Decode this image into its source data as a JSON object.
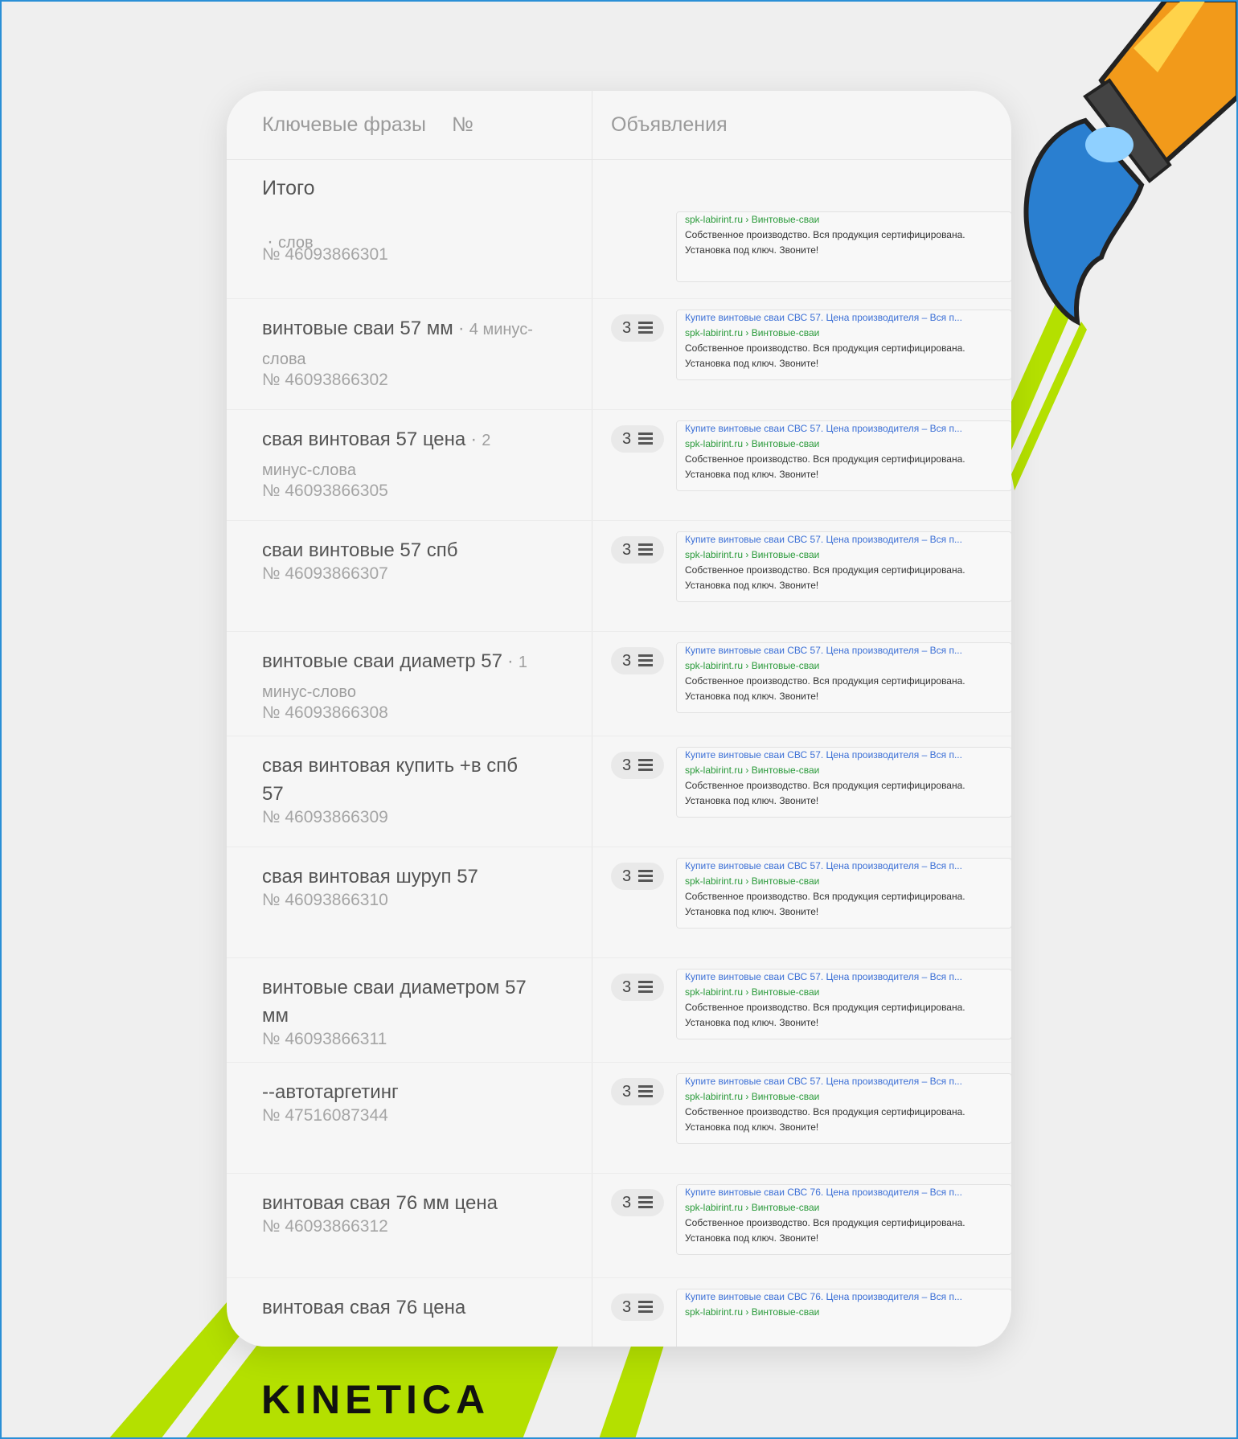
{
  "header": {
    "col_keywords": "Ключевые фразы",
    "col_number": "№",
    "col_ads": "Объявления"
  },
  "total_label": "Итого",
  "rows": [
    {
      "phrase": "",
      "minus": "слов",
      "number": "№ 46093866301",
      "count": "",
      "ad": {
        "title": "",
        "url": "spk-labirint.ru › Винтовые-сваи",
        "desc": "Собственное производство. Вся продукция сертифицирована. Установка под ключ. Звоните!"
      }
    },
    {
      "phrase": "винтовые сваи 57 мм",
      "minus": "4 минус-слова",
      "number": "№ 46093866302",
      "count": "3",
      "ad": {
        "title": "Купите винтовые сваи СВС 57. Цена производителя – Вся п...",
        "url": "spk-labirint.ru › Винтовые-сваи",
        "desc": "Собственное производство. Вся продукция сертифицирована. Установка под ключ. Звоните!"
      }
    },
    {
      "phrase": "свая винтовая 57 цена",
      "minus": "2 минус-слова",
      "number": "№ 46093866305",
      "count": "3",
      "ad": {
        "title": "Купите винтовые сваи СВС 57. Цена производителя – Вся п...",
        "url": "spk-labirint.ru › Винтовые-сваи",
        "desc": "Собственное производство. Вся продукция сертифицирована. Установка под ключ. Звоните!"
      }
    },
    {
      "phrase": "сваи винтовые 57 спб",
      "minus": "",
      "number": "№ 46093866307",
      "count": "3",
      "ad": {
        "title": "Купите винтовые сваи СВС 57. Цена производителя – Вся п...",
        "url": "spk-labirint.ru › Винтовые-сваи",
        "desc": "Собственное производство. Вся продукция сертифицирована. Установка под ключ. Звоните!"
      }
    },
    {
      "phrase": "винтовые сваи диаметр 57",
      "minus": "1 минус-слово",
      "number": "№ 46093866308",
      "count": "3",
      "ad": {
        "title": "Купите винтовые сваи СВС 57. Цена производителя – Вся п...",
        "url": "spk-labirint.ru › Винтовые-сваи",
        "desc": "Собственное производство. Вся продукция сертифицирована. Установка под ключ. Звоните!"
      }
    },
    {
      "phrase": "свая винтовая купить +в спб 57",
      "minus": "",
      "number": "№ 46093866309",
      "count": "3",
      "ad": {
        "title": "Купите винтовые сваи СВС 57. Цена производителя – Вся п...",
        "url": "spk-labirint.ru › Винтовые-сваи",
        "desc": "Собственное производство. Вся продукция сертифицирована. Установка под ключ. Звоните!"
      }
    },
    {
      "phrase": "свая винтовая шуруп 57",
      "minus": "",
      "number": "№ 46093866310",
      "count": "3",
      "ad": {
        "title": "Купите винтовые сваи СВС 57. Цена производителя – Вся п...",
        "url": "spk-labirint.ru › Винтовые-сваи",
        "desc": "Собственное производство. Вся продукция сертифицирована. Установка под ключ. Звоните!"
      }
    },
    {
      "phrase": "винтовые сваи диаметром 57 мм",
      "minus": "",
      "number": "№ 46093866311",
      "count": "3",
      "ad": {
        "title": "Купите винтовые сваи СВС 57. Цена производителя – Вся п...",
        "url": "spk-labirint.ru › Винтовые-сваи",
        "desc": "Собственное производство. Вся продукция сертифицирована. Установка под ключ. Звоните!"
      }
    },
    {
      "phrase": "--автотаргетинг",
      "minus": "",
      "number": "№ 47516087344",
      "count": "3",
      "ad": {
        "title": "Купите винтовые сваи СВС 57. Цена производителя – Вся п...",
        "url": "spk-labirint.ru › Винтовые-сваи",
        "desc": "Собственное производство. Вся продукция сертифицирована. Установка под ключ. Звоните!"
      }
    },
    {
      "phrase": "винтовая свая 76 мм цена",
      "minus": "",
      "number": "№ 46093866312",
      "count": "3",
      "ad": {
        "title": "Купите винтовые сваи СВС 76. Цена производителя – Вся п...",
        "url": "spk-labirint.ru › Винтовые-сваи",
        "desc": "Собственное производство. Вся продукция сертифицирована. Установка под ключ. Звоните!"
      }
    },
    {
      "phrase": "винтовая свая 76 цена",
      "minus": "",
      "number": "",
      "count": "3",
      "ad": {
        "title": "Купите винтовые сваи СВС 76. Цена производителя – Вся п...",
        "url": "spk-labirint.ru › Винтовые-сваи",
        "desc": ""
      }
    }
  ],
  "logo": "KINETICA",
  "colors": {
    "accent_green": "#b4e000",
    "frame_blue": "#2a8fd6",
    "ad_title": "#3b6fd6",
    "ad_url": "#2a9a3a"
  },
  "decor_icon": "rocket-pen-icon"
}
